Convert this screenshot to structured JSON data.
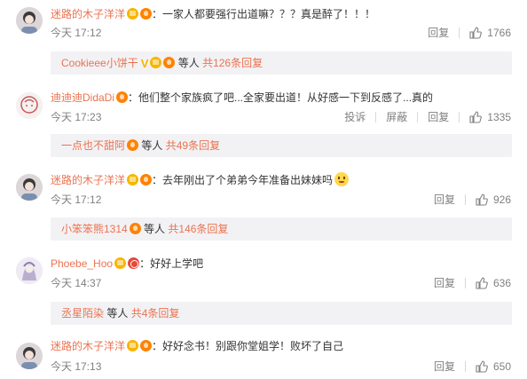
{
  "comments": [
    {
      "author": "迷路的木子洋洋",
      "text": "：一家人都要强行出道嘛？？？真是醉了！！！",
      "time": "今天 17:12",
      "reply_label": "回复",
      "likes": "1766",
      "thread": {
        "author": "Cookieee小饼干",
        "etc": "等人",
        "more": "共126条回复"
      }
    },
    {
      "author": "迪迪迪DidaDi",
      "text": "：他们整个家族疯了吧...全家要出道！从好感一下到反感了...真的",
      "time": "今天 17:23",
      "report_label": "投诉",
      "block_label": "屏蔽",
      "reply_label": "回复",
      "likes": "1335",
      "thread": {
        "author": "一点也不甜阿",
        "etc": "等人",
        "more": "共49条回复"
      }
    },
    {
      "author": "迷路的木子洋洋",
      "text": "：去年刚出了个弟弟今年准备出妹妹吗",
      "time": "今天 17:12",
      "reply_label": "回复",
      "likes": "926",
      "thread": {
        "author": "小笨笨熊1314",
        "etc": "等人",
        "more": "共146条回复"
      }
    },
    {
      "author": "Phoebe_Hoo",
      "text": "：好好上学吧",
      "time": "今天 14:37",
      "reply_label": "回复",
      "likes": "636",
      "thread": {
        "author": "丞星陌染",
        "etc": "等人",
        "more": "共4条回复"
      }
    },
    {
      "author": "迷路的木子洋洋",
      "text": "：好好念书！别跟你堂姐学！败坏了自己",
      "time": "今天 17:13",
      "reply_label": "回复",
      "likes": "650"
    }
  ],
  "colors": {
    "name": "#eb7350",
    "meta": "#808080",
    "reply_bg": "#f2f2f5",
    "vip_badge": "#f7b500",
    "fan_badge": "#ff8200"
  },
  "icons": {
    "like": "thumbs-up-icon",
    "vip": "vip-badge-icon",
    "fan": "fan-badge-icon",
    "emoji": "emoji-face-icon"
  }
}
